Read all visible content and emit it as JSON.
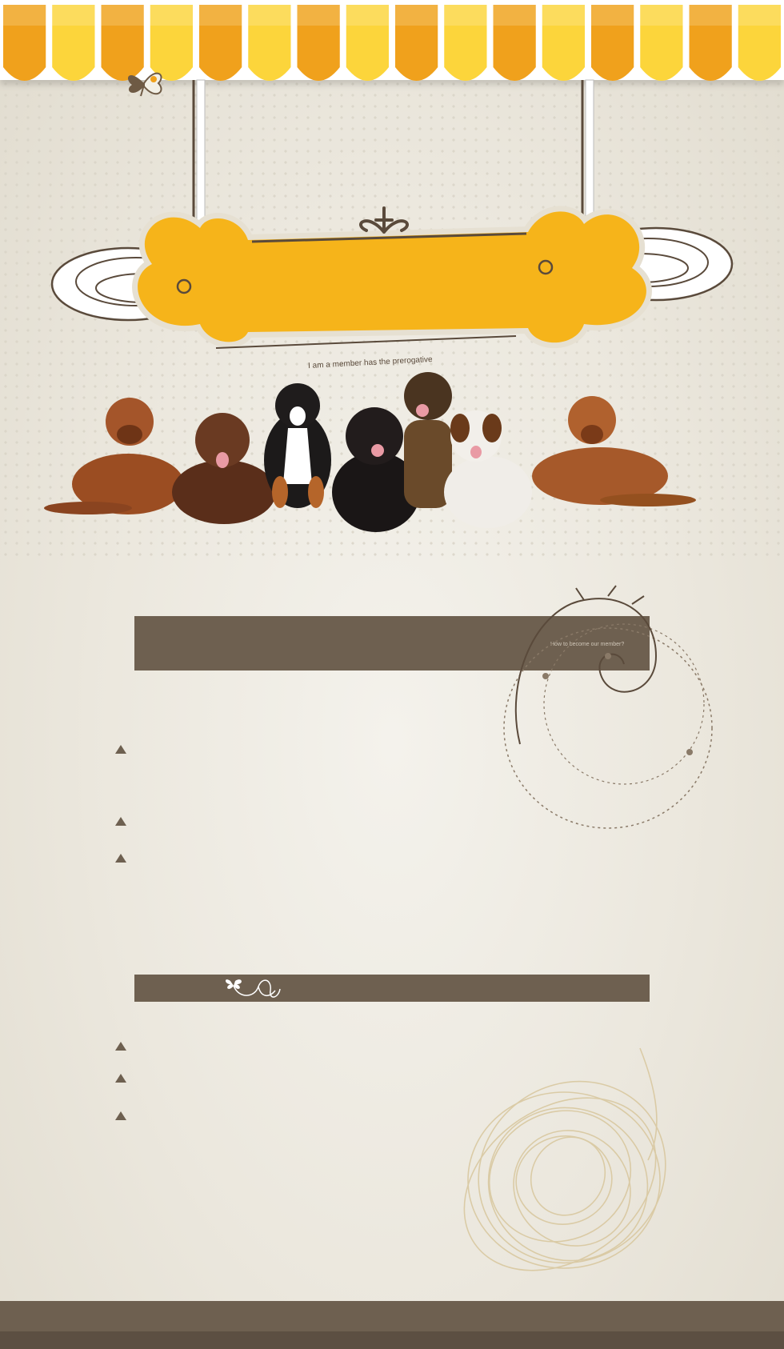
{
  "sign": {
    "caption": "I am a member has the prerogative"
  },
  "section1": {
    "subtitle": "How to become our member?"
  },
  "colors": {
    "awning_orange": "#f0a11a",
    "awning_yellow": "#fcd53a",
    "bone_yellow": "#f6b41a",
    "bar_brown": "#6e6050",
    "background": "#ebe7dd"
  },
  "icons": {
    "awning": "striped-awning",
    "butterfly": "butterfly-icon",
    "bone_sign": "bone-sign",
    "bullet": "triangle-bullet-icon"
  },
  "dogs_count": 7
}
